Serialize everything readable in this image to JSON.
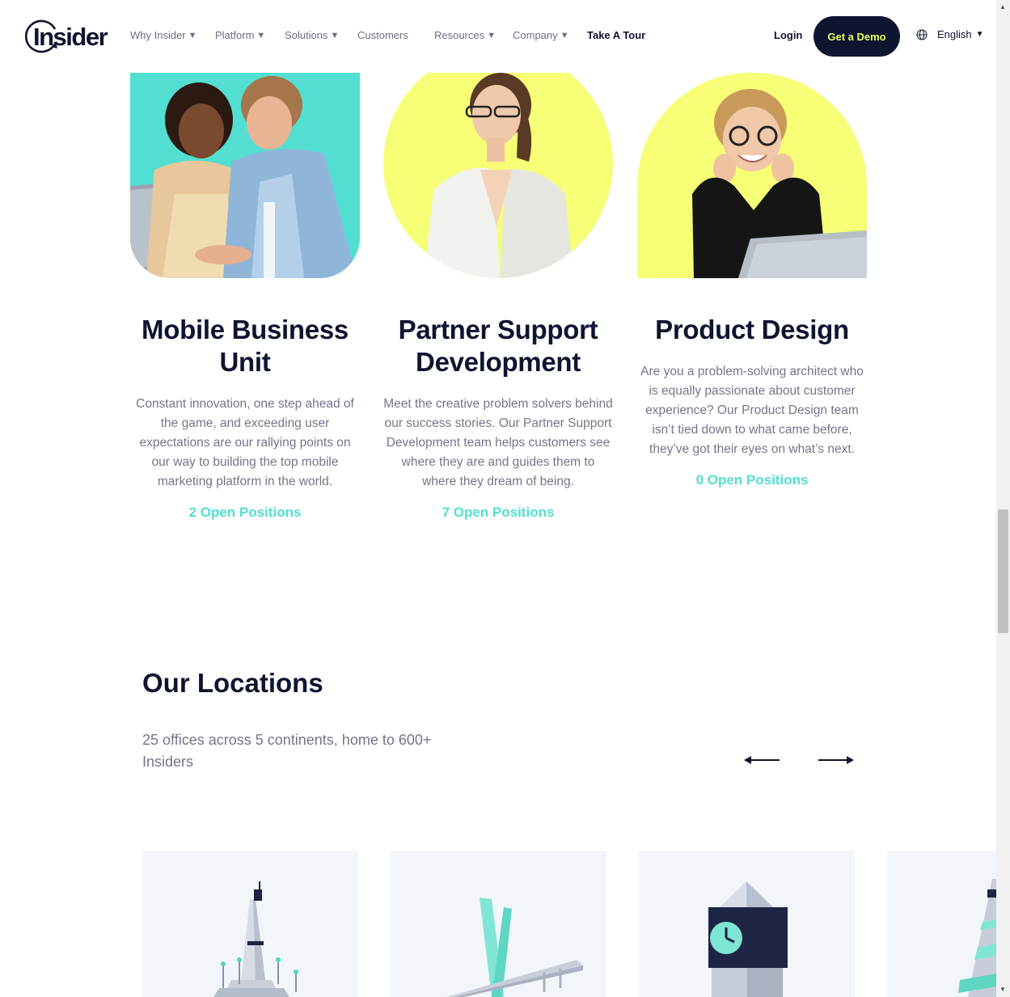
{
  "header": {
    "logo_text": "Insider",
    "nav": [
      {
        "label": "Why Insider",
        "caret": true
      },
      {
        "label": "Platform",
        "caret": true
      },
      {
        "label": "Solutions",
        "caret": true
      },
      {
        "label": "Customers",
        "caret": false
      },
      {
        "label": "Resources",
        "caret": true
      },
      {
        "label": "Company",
        "caret": true
      },
      {
        "label": "Take A Tour",
        "caret": false
      }
    ],
    "login_label": "Login",
    "demo_label": "Get a Demo",
    "language": "English"
  },
  "teams": [
    {
      "name_line1": "Mobile Business",
      "name_line2": "Unit",
      "description": "Constant innovation, one step ahead of the game, and exceeding user expectations are our rallying points on our way to building the top mobile marketing platform in the world.",
      "link": "2 Open Positions"
    },
    {
      "name_line1": "Partner Support",
      "name_line2": "Development",
      "description": "Meet the creative problem solvers behind our success stories. Our Partner Support Development team helps customers see where they are and guides them to where they dream of being.",
      "link": "7 Open Positions"
    },
    {
      "name_line1": "Product Design",
      "name_line2": "",
      "description": "Are you a problem-solving architect who is equally passionate about customer experience? Our Product Design team isn’t tied down to what came before, they’ve got their eyes on what’s next.",
      "link": "0 Open Positions"
    }
  ],
  "locations": {
    "title": "Our Locations",
    "subtitle": "25 offices across 5 continents, home to 600+ Insiders"
  },
  "colors": {
    "navy": "#0f1430",
    "teal": "#52dfd1",
    "yellow": "#f6ff75",
    "demo_text": "#e9ff5e",
    "body_text": "#73768a"
  },
  "icons": [
    "globe-icon",
    "caret-down-icon",
    "arrow-left-icon",
    "arrow-right-icon"
  ]
}
